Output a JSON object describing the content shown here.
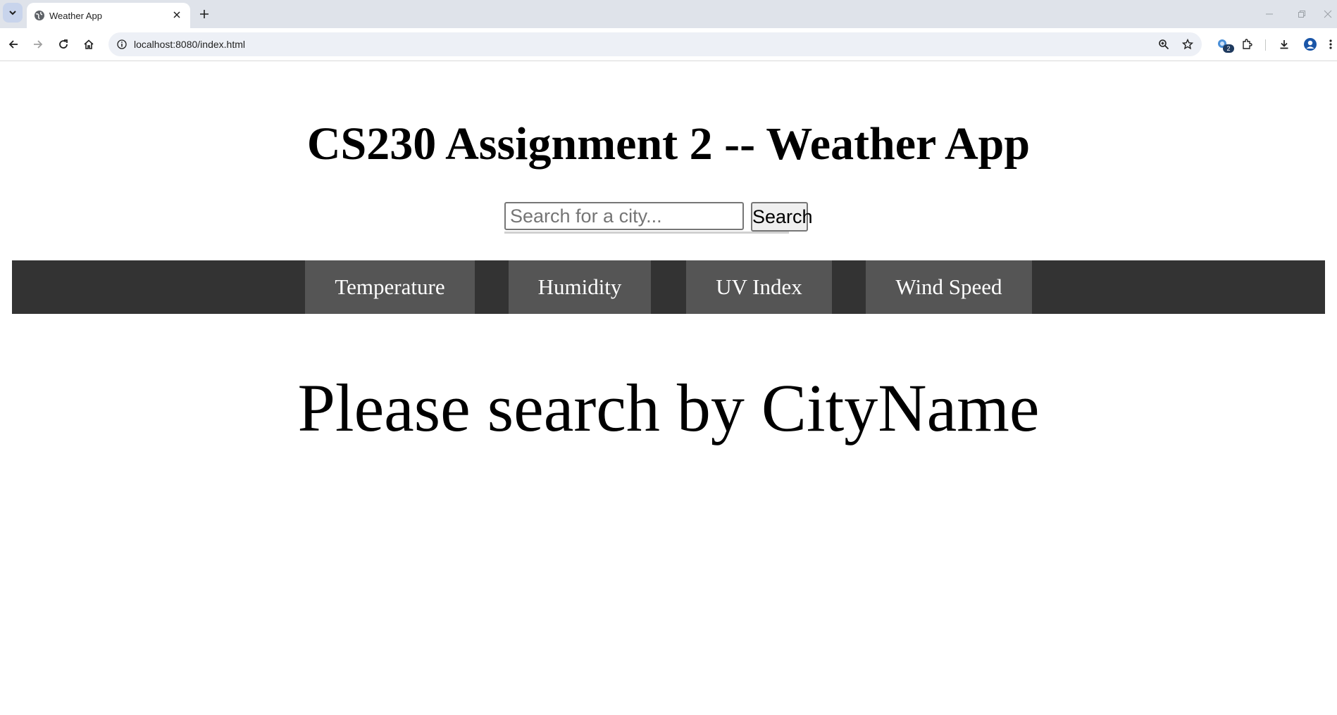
{
  "browser": {
    "tab_title": "Weather App",
    "url": "localhost:8080/index.html",
    "extension_badge": "2"
  },
  "page": {
    "title": "CS230 Assignment 2 -- Weather App",
    "search": {
      "placeholder": "Search for a city...",
      "value": "",
      "button_label": "Search"
    },
    "nav": [
      {
        "label": "Temperature"
      },
      {
        "label": "Humidity"
      },
      {
        "label": "UV Index"
      },
      {
        "label": "Wind Speed"
      }
    ],
    "message": "Please search by CityName"
  },
  "colors": {
    "tabstrip": "#dfe3ea",
    "navbar_bg": "#333333",
    "nav_item_bg": "#555555",
    "nav_item_text": "#ffffff"
  },
  "icons": [
    "tab-search-icon",
    "globe-icon",
    "close-icon",
    "plus-icon",
    "minimize-icon",
    "restore-icon",
    "window-close-icon",
    "back-icon",
    "forward-icon",
    "reload-icon",
    "home-icon",
    "site-info-icon",
    "zoom-icon",
    "star-icon",
    "extension-badge-icon",
    "puzzle-icon",
    "download-icon",
    "profile-icon",
    "menu-icon"
  ]
}
